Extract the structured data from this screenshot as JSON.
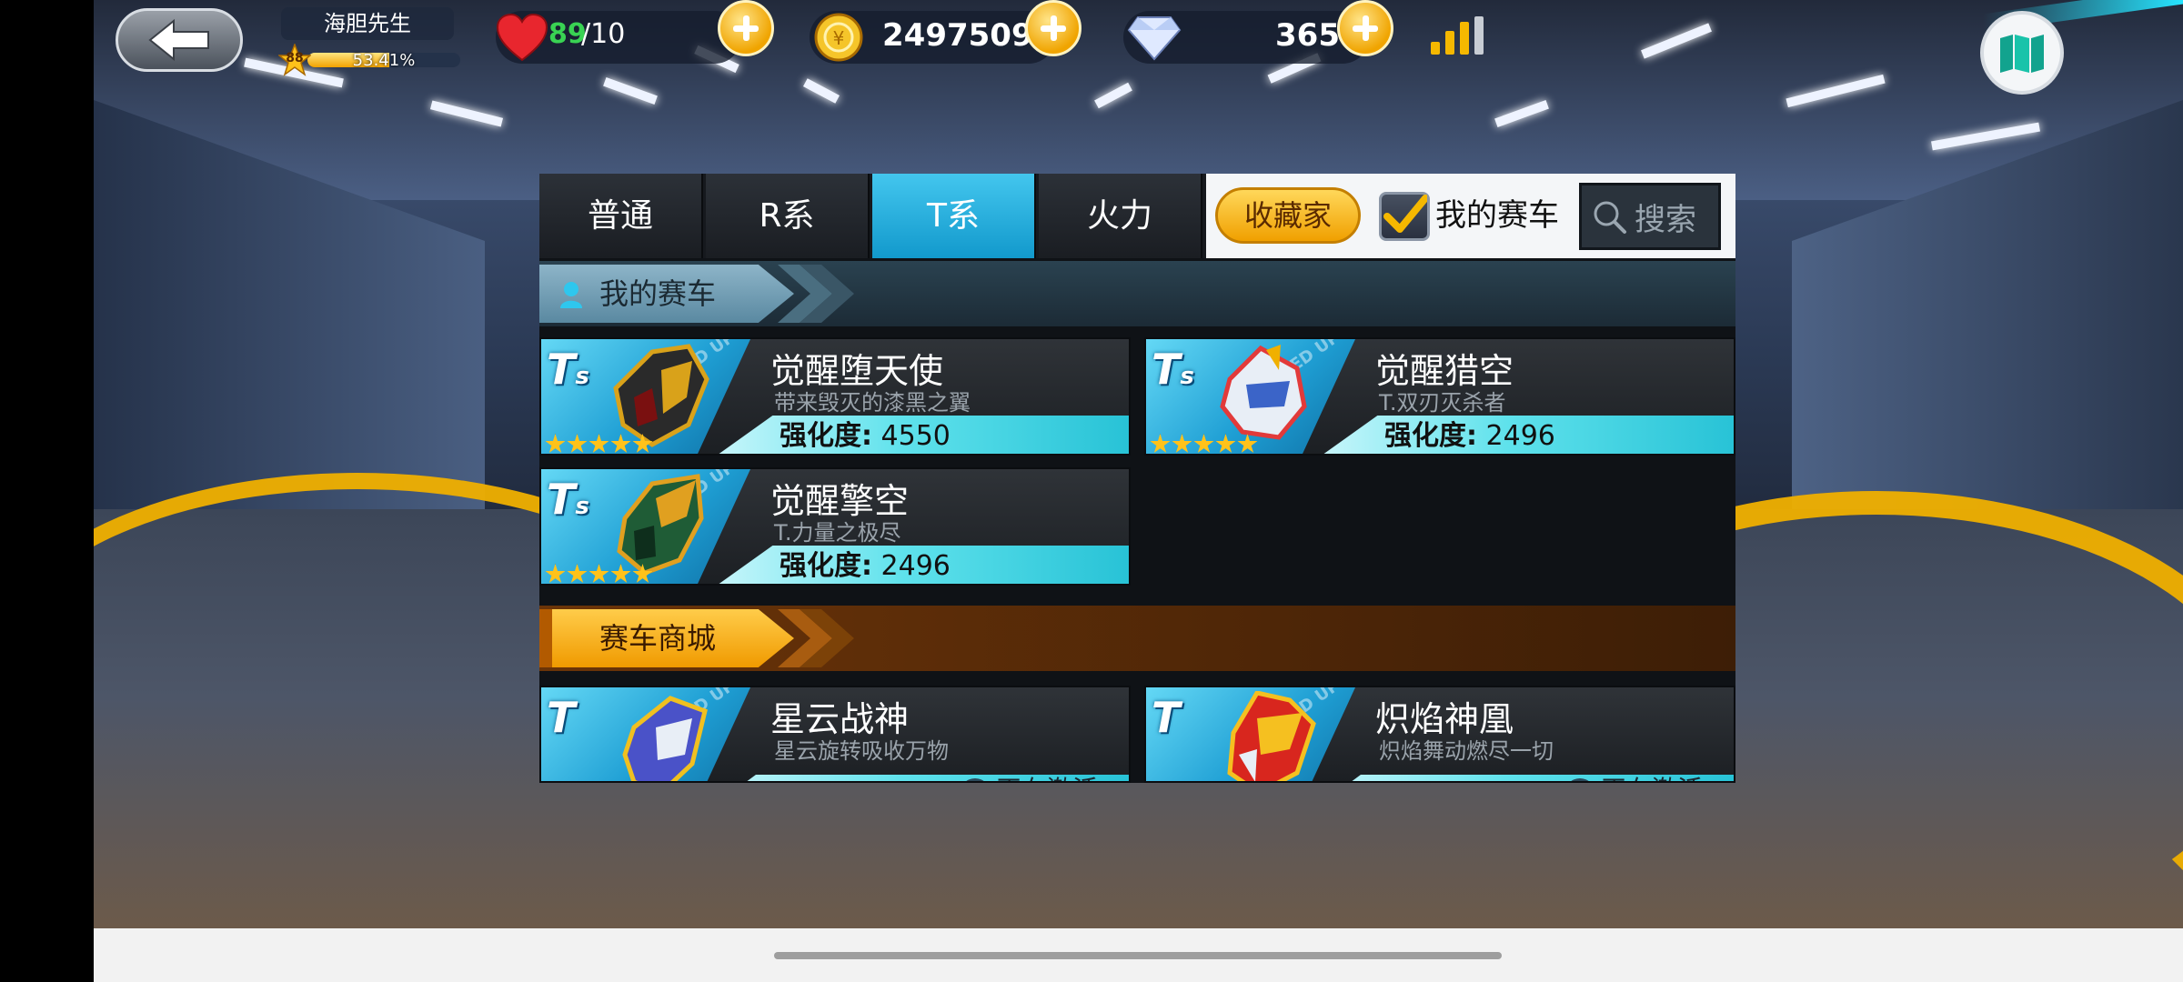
{
  "hud": {
    "player_name": "海胆先生",
    "level": "88",
    "exp_text": "53.41%",
    "exp_fraction": 0.5341,
    "stamina_current": "89",
    "stamina_max": "/10",
    "coins": "2497509",
    "diamonds": "365"
  },
  "tabs": [
    {
      "label": "普通",
      "active": false
    },
    {
      "label": "R系",
      "active": false
    },
    {
      "label": "T系",
      "active": true
    },
    {
      "label": "火力",
      "active": false
    }
  ],
  "toolbar": {
    "collector_label": "收藏家",
    "my_cars_checkbox_label": "我的赛车",
    "my_cars_checked": true,
    "search_label": "搜索"
  },
  "sections": {
    "mine_title": "我的赛车",
    "shop_title": "赛车商城"
  },
  "my_cars": [
    {
      "name": "觉醒堕天使",
      "desc": "带来毁灭的漆黑之翼",
      "badge": "Ts",
      "stars": 5,
      "enh_label": "强化度:",
      "enh_value": "4550",
      "accent": "#d9a21a"
    },
    {
      "name": "觉醒猎空",
      "desc": "T.双刃灭杀者",
      "badge": "Ts",
      "stars": 5,
      "enh_label": "强化度:",
      "enh_value": "2496",
      "accent": "#e23a3a"
    },
    {
      "name": "觉醒擎空",
      "desc": "T.力量之极尽",
      "badge": "Ts",
      "stars": 5,
      "enh_label": "强化度:",
      "enh_value": "2496",
      "accent": "#2f8f4a"
    }
  ],
  "shop_cars": [
    {
      "name": "星云战神",
      "desc": "星云旋转吸收万物",
      "badge": "T",
      "status": "正在激活",
      "accent": "#5a62d8"
    },
    {
      "name": "炽焰神凰",
      "desc": "炽焰舞动燃尽一切",
      "badge": "T",
      "status": "正在激活",
      "accent": "#e85b1e"
    }
  ],
  "colors": {
    "accent_cyan": "#1299cc",
    "gold": "#f0a000",
    "stamina_green": "#39d353"
  }
}
